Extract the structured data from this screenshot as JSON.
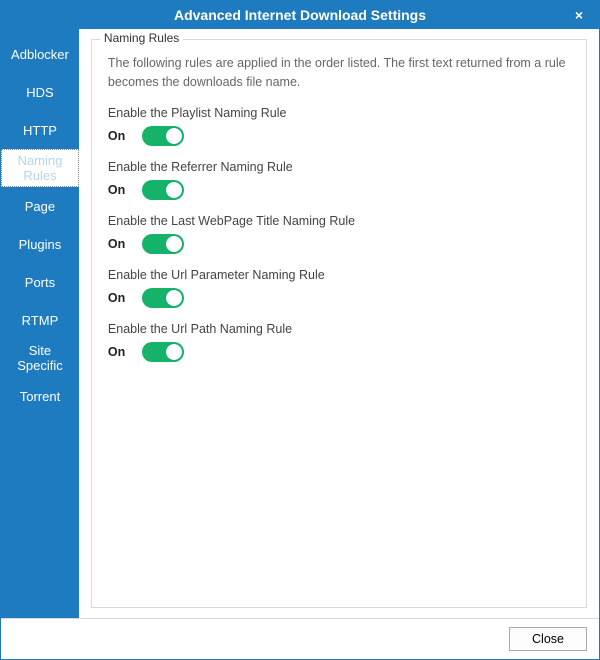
{
  "window": {
    "title": "Advanced Internet Download Settings"
  },
  "sidebar": {
    "items": [
      {
        "label": "Adblocker",
        "selected": false
      },
      {
        "label": "HDS",
        "selected": false
      },
      {
        "label": "HTTP",
        "selected": false
      },
      {
        "label": "Naming Rules",
        "selected": true
      },
      {
        "label": "Page",
        "selected": false
      },
      {
        "label": "Plugins",
        "selected": false
      },
      {
        "label": "Ports",
        "selected": false
      },
      {
        "label": "RTMP",
        "selected": false
      },
      {
        "label": "Site Specific",
        "selected": false
      },
      {
        "label": "Torrent",
        "selected": false
      }
    ]
  },
  "panel": {
    "group_title": "Naming Rules",
    "description": "The following rules are applied in the order listed. The first text returned from a rule becomes the downloads file name.",
    "rules": [
      {
        "label": "Enable the Playlist Naming Rule",
        "state": "On",
        "on": true
      },
      {
        "label": "Enable the Referrer Naming Rule",
        "state": "On",
        "on": true
      },
      {
        "label": "Enable the Last WebPage Title Naming Rule",
        "state": "On",
        "on": true
      },
      {
        "label": "Enable the Url Parameter Naming Rule",
        "state": "On",
        "on": true
      },
      {
        "label": "Enable the Url Path Naming Rule",
        "state": "On",
        "on": true
      }
    ]
  },
  "footer": {
    "close_label": "Close"
  },
  "icons": {
    "close": "×"
  }
}
